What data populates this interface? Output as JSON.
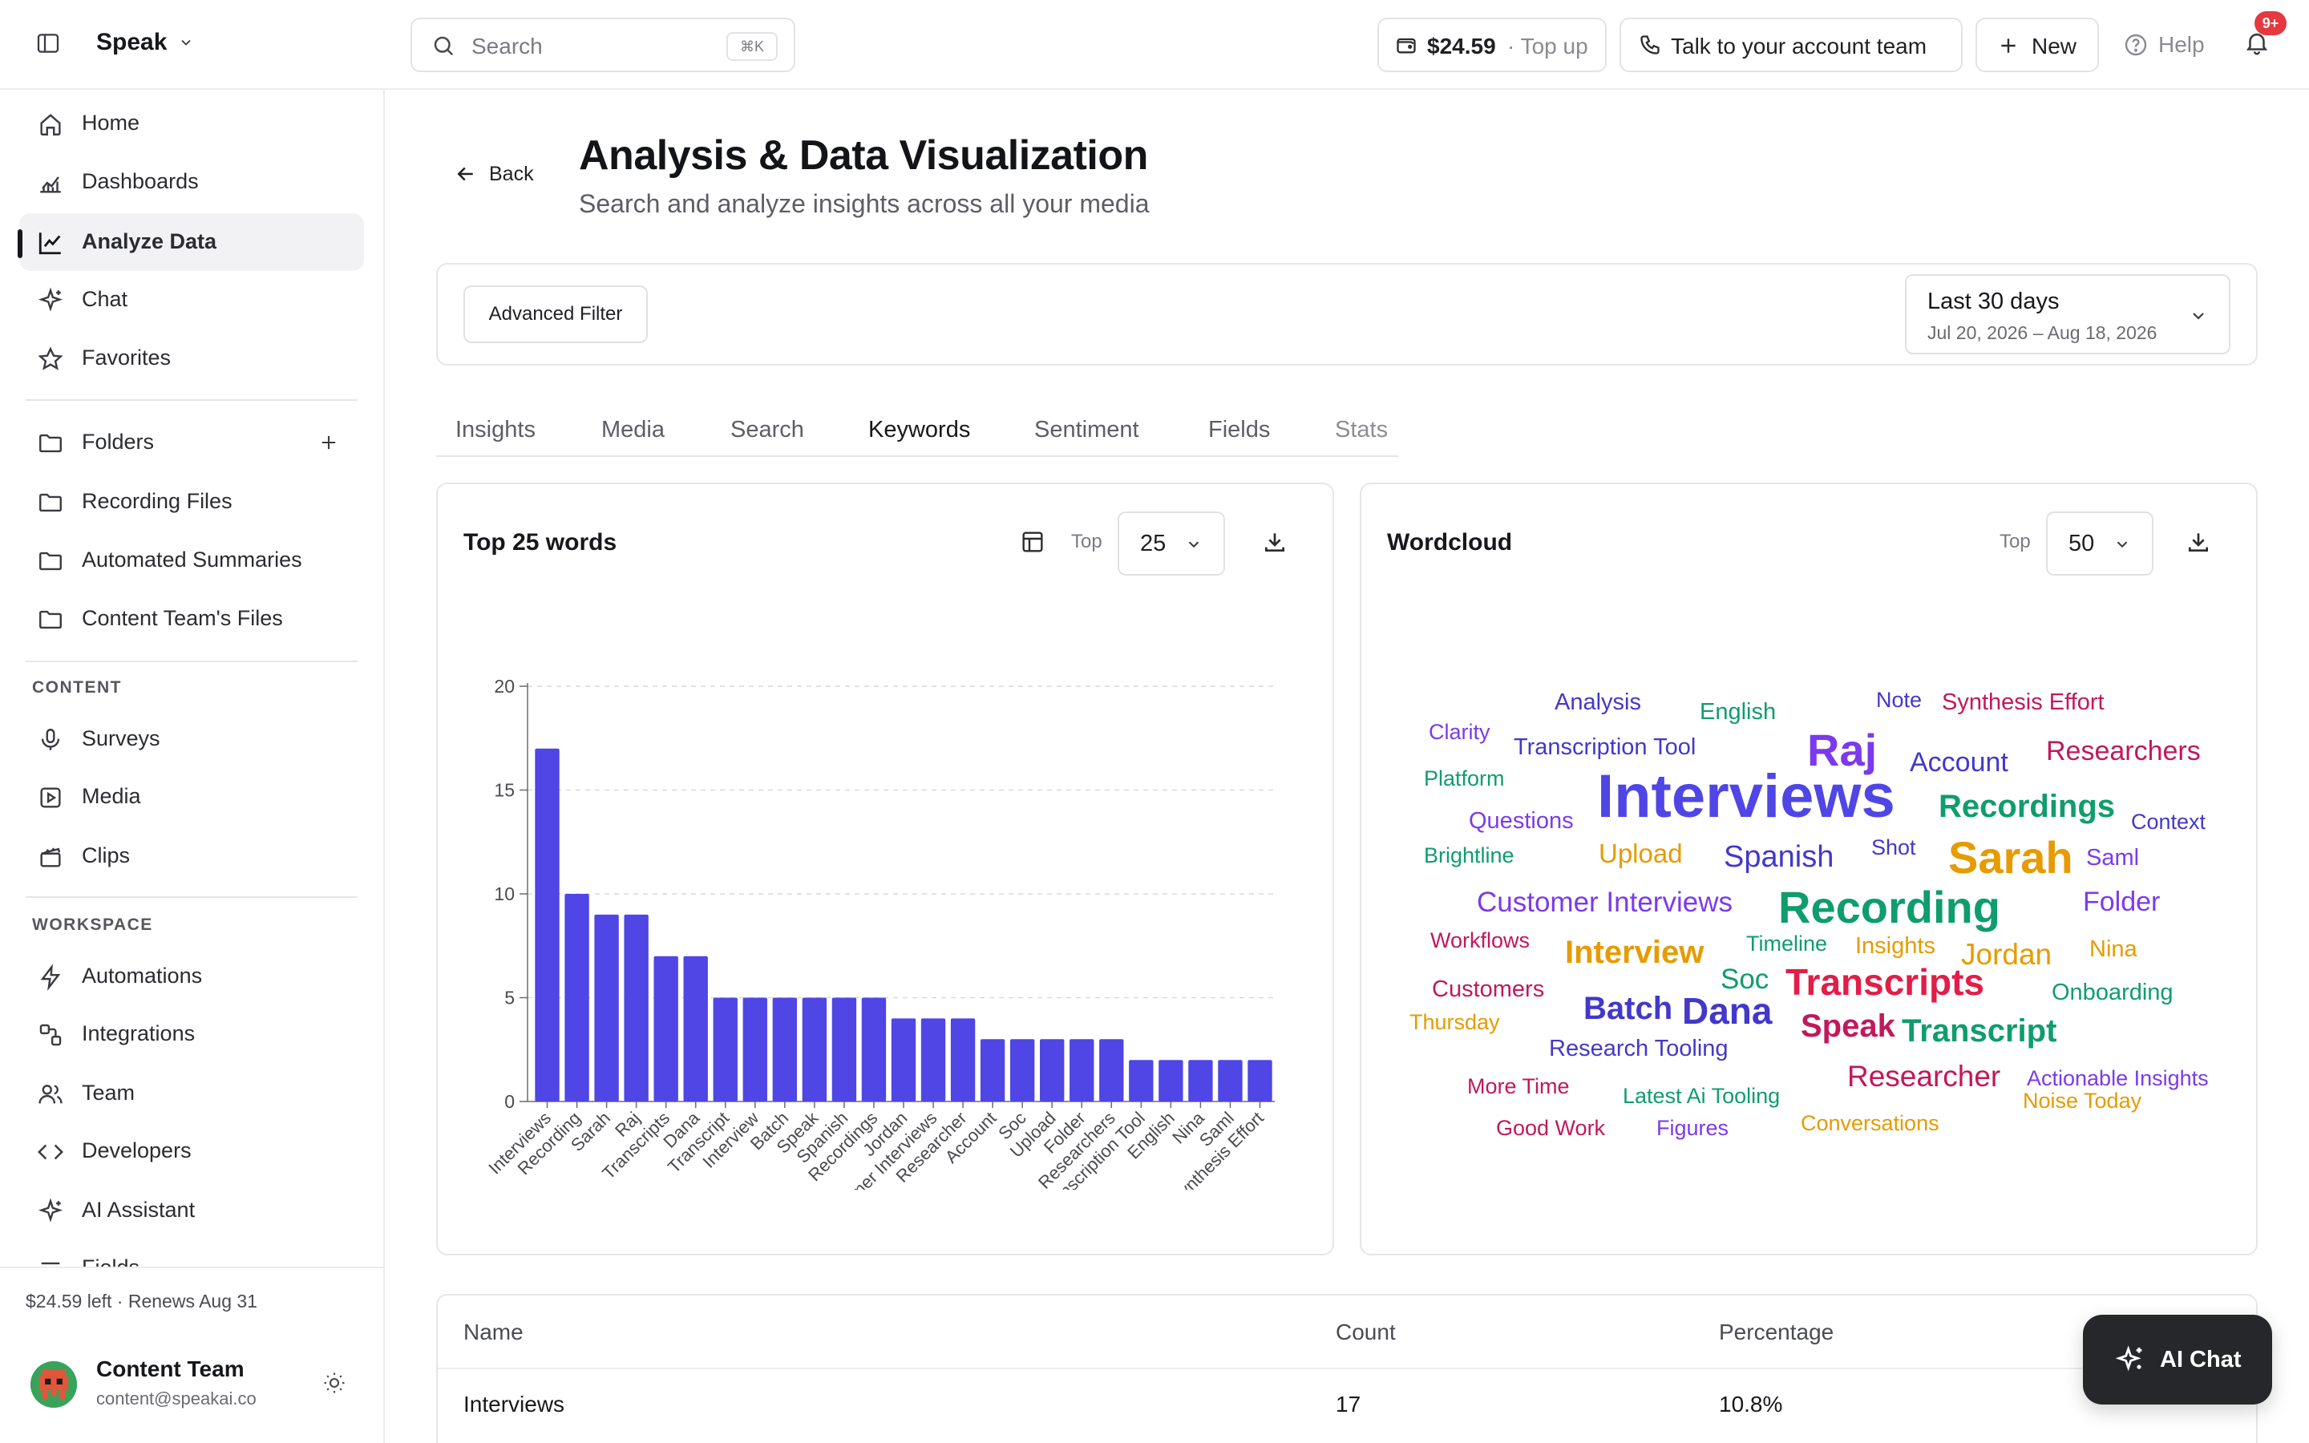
{
  "app": {
    "brand": "Speak"
  },
  "search": {
    "placeholder": "Search",
    "shortcut": "⌘K"
  },
  "topbar": {
    "balance": "$24.59",
    "topup": "· Top up",
    "talk": "Talk to your account team",
    "new": "New",
    "help": "Help",
    "notif_badge": "9+"
  },
  "sidebar": {
    "nav": [
      {
        "label": "Home",
        "icon": "home-icon"
      },
      {
        "label": "Dashboards",
        "icon": "dashboard-icon"
      },
      {
        "label": "Analyze Data",
        "icon": "line-chart-icon",
        "active": true
      },
      {
        "label": "Chat",
        "icon": "sparkle-icon"
      },
      {
        "label": "Favorites",
        "icon": "star-icon"
      }
    ],
    "folders_label": "Folders",
    "folders": [
      "Recording Files",
      "Automated Summaries",
      "Content Team's Files"
    ],
    "content_label": "CONTENT",
    "content": [
      {
        "label": "Surveys",
        "icon": "microphone-icon"
      },
      {
        "label": "Media",
        "icon": "play-square-icon"
      },
      {
        "label": "Clips",
        "icon": "clapperboard-icon"
      }
    ],
    "workspace_label": "WORKSPACE",
    "workspace": [
      {
        "label": "Automations",
        "icon": "lightning-icon"
      },
      {
        "label": "Integrations",
        "icon": "integrations-icon"
      },
      {
        "label": "Team",
        "icon": "team-icon"
      },
      {
        "label": "Developers",
        "icon": "code-icon"
      },
      {
        "label": "AI Assistant",
        "icon": "sparkle-icon"
      },
      {
        "label": "Fields",
        "icon": "fields-icon"
      }
    ],
    "footer": {
      "plan": "$24.59 left · Renews Aug 31",
      "user_name": "Content Team",
      "user_email": "content@speakai.co"
    }
  },
  "page": {
    "back": "Back",
    "title": "Analysis & Data Visualization",
    "subtitle": "Search and analyze insights across all your media"
  },
  "filters": {
    "advanced": "Advanced Filter",
    "range_label": "Last 30 days",
    "range_dates": "Jul 20, 2026 – Aug 18, 2026"
  },
  "tabs": [
    {
      "label": "Insights"
    },
    {
      "label": "Media"
    },
    {
      "label": "Search"
    },
    {
      "label": "Keywords",
      "active": true
    },
    {
      "label": "Sentiment"
    },
    {
      "label": "Fields"
    },
    {
      "label": "Stats"
    }
  ],
  "bar_card": {
    "title": "Top 25 words",
    "top_label": "Top",
    "top_value": "25"
  },
  "wordcloud_card": {
    "title": "Wordcloud",
    "top_label": "Top",
    "top_value": "50"
  },
  "chart_data": {
    "type": "bar",
    "title": "Top 25 words",
    "xlabel": "",
    "ylabel": "",
    "ylim": [
      0,
      20
    ],
    "yticks": [
      0,
      5,
      10,
      15,
      20
    ],
    "grid": true,
    "color": "#4f46e5",
    "categories": [
      "Interviews",
      "Recording",
      "Sarah",
      "Raj",
      "Transcripts",
      "Dana",
      "Transcript",
      "Interview",
      "Batch",
      "Speak",
      "Spanish",
      "Recordings",
      "Jordan",
      "Customer Interviews",
      "Researcher",
      "Account",
      "Soc",
      "Upload",
      "Folder",
      "Researchers",
      "Transcription Tool",
      "English",
      "Nina",
      "Saml",
      "Synthesis Effort"
    ],
    "values": [
      17,
      10,
      9,
      9,
      7,
      7,
      5,
      5,
      5,
      5,
      5,
      5,
      4,
      4,
      4,
      3,
      3,
      3,
      3,
      3,
      2,
      2,
      2,
      2,
      2
    ]
  },
  "wordcloud": [
    {
      "text": "Analysis",
      "color": "#4338ca",
      "size": 29
    },
    {
      "text": "English",
      "color": "#0f9d6e",
      "size": 29
    },
    {
      "text": "Note",
      "color": "#4338ca",
      "size": 27
    },
    {
      "text": "Synthesis Effort",
      "color": "#c2185b",
      "size": 29
    },
    {
      "text": "Clarity",
      "color": "#7c3aed",
      "size": 27
    },
    {
      "text": "Transcription Tool",
      "color": "#4338ca",
      "size": 29
    },
    {
      "text": "Raj",
      "color": "#7c3aed",
      "size": 56
    },
    {
      "text": "Account",
      "color": "#4338ca",
      "size": 34
    },
    {
      "text": "Researchers",
      "color": "#c2185b",
      "size": 34
    },
    {
      "text": "Platform",
      "color": "#0f9d6e",
      "size": 27
    },
    {
      "text": "Interviews",
      "color": "#4f46e5",
      "size": 76
    },
    {
      "text": "Recordings",
      "color": "#0f9d6e",
      "size": 40
    },
    {
      "text": "Questions",
      "color": "#7c3aed",
      "size": 29
    },
    {
      "text": "Context",
      "color": "#4338ca",
      "size": 27
    },
    {
      "text": "Brightline",
      "color": "#0f9d6e",
      "size": 27
    },
    {
      "text": "Upload",
      "color": "#e69b00",
      "size": 33
    },
    {
      "text": "Spanish",
      "color": "#4338ca",
      "size": 38
    },
    {
      "text": "Shot",
      "color": "#4338ca",
      "size": 27
    },
    {
      "text": "Sarah",
      "color": "#e69b00",
      "size": 56
    },
    {
      "text": "Saml",
      "color": "#7c3aed",
      "size": 29
    },
    {
      "text": "Customer Interviews",
      "color": "#7c3aed",
      "size": 35
    },
    {
      "text": "Recording",
      "color": "#0f9d6e",
      "size": 56
    },
    {
      "text": "Folder",
      "color": "#7c3aed",
      "size": 34
    },
    {
      "text": "Workflows",
      "color": "#c2185b",
      "size": 27
    },
    {
      "text": "Interview",
      "color": "#e69b00",
      "size": 40
    },
    {
      "text": "Timeline",
      "color": "#0f9d6e",
      "size": 27
    },
    {
      "text": "Insights",
      "color": "#e69b00",
      "size": 29
    },
    {
      "text": "Jordan",
      "color": "#e69b00",
      "size": 37
    },
    {
      "text": "Nina",
      "color": "#e69b00",
      "size": 29
    },
    {
      "text": "Customers",
      "color": "#c2185b",
      "size": 29
    },
    {
      "text": "Soc",
      "color": "#0f9d6e",
      "size": 35
    },
    {
      "text": "Transcripts",
      "color": "#e11d48",
      "size": 46
    },
    {
      "text": "Onboarding",
      "color": "#0f9d6e",
      "size": 29
    },
    {
      "text": "Thursday",
      "color": "#e69b00",
      "size": 27
    },
    {
      "text": "Batch",
      "color": "#4338ca",
      "size": 40
    },
    {
      "text": "Dana",
      "color": "#4338ca",
      "size": 46
    },
    {
      "text": "Speak",
      "color": "#c2185b",
      "size": 40
    },
    {
      "text": "Transcript",
      "color": "#0f9d6e",
      "size": 40
    },
    {
      "text": "Research Tooling",
      "color": "#4338ca",
      "size": 29
    },
    {
      "text": "Researcher",
      "color": "#c2185b",
      "size": 37
    },
    {
      "text": "More Time",
      "color": "#c2185b",
      "size": 27
    },
    {
      "text": "Latest Ai Tooling",
      "color": "#0f9d6e",
      "size": 27
    },
    {
      "text": "Actionable Insights",
      "color": "#7c3aed",
      "size": 27
    },
    {
      "text": "Noise Today",
      "color": "#e69b00",
      "size": 27
    },
    {
      "text": "Good Work",
      "color": "#c2185b",
      "size": 27
    },
    {
      "text": "Figures",
      "color": "#7c3aed",
      "size": 27
    },
    {
      "text": "Conversations",
      "color": "#e69b00",
      "size": 27
    }
  ],
  "table": {
    "headers": [
      "Name",
      "Count",
      "Percentage"
    ],
    "rows": [
      [
        "Interviews",
        "17",
        "10.8%"
      ]
    ]
  },
  "ai_chat": {
    "label": "AI Chat"
  }
}
